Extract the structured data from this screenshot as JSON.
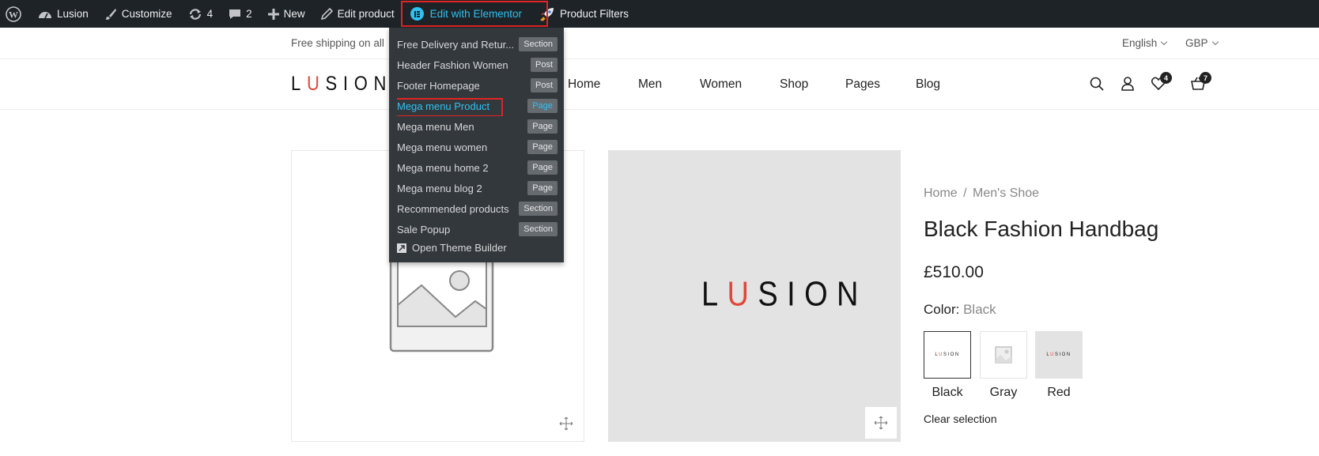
{
  "adminbar": {
    "site_name": "Lusion",
    "customize": "Customize",
    "updates": "4",
    "comments": "2",
    "new": "New",
    "edit_product": "Edit product",
    "edit_elementor": "Edit with Elementor",
    "product_filters": "Product Filters"
  },
  "elementor_menu": {
    "items": [
      {
        "label": "Free Delivery and Retur...",
        "tag": "Section"
      },
      {
        "label": "Header Fashion Women",
        "tag": "Post"
      },
      {
        "label": "Footer Homepage",
        "tag": "Post"
      },
      {
        "label": "Mega menu Product",
        "tag": "Page",
        "active": true
      },
      {
        "label": "Mega menu Men",
        "tag": "Page"
      },
      {
        "label": "Mega menu women",
        "tag": "Page"
      },
      {
        "label": "Mega menu home 2",
        "tag": "Page"
      },
      {
        "label": "Mega menu blog 2",
        "tag": "Page"
      },
      {
        "label": "Recommended products",
        "tag": "Section"
      },
      {
        "label": "Sale Popup",
        "tag": "Section"
      }
    ],
    "open_builder": "Open Theme Builder"
  },
  "topbar": {
    "shipping": "Free shipping on all",
    "language": "English",
    "currency": "GBP"
  },
  "header": {
    "logo": {
      "l": "L",
      "u": "U",
      "rest": "SION"
    },
    "nav": [
      "Home",
      "Men",
      "Women",
      "Shop",
      "Pages",
      "Blog"
    ],
    "wishlist_count": "4",
    "cart_count": "7"
  },
  "product": {
    "breadcrumb": {
      "home": "Home",
      "sep": "/",
      "category": "Men's Shoe"
    },
    "title": "Black Fashion Handbag",
    "price": "£510.00",
    "color_label": "Color:",
    "color_value": "Black",
    "swatches": [
      "Black",
      "Gray",
      "Red"
    ],
    "clear": "Clear selection"
  },
  "colors": {
    "adminbar_bg": "#1d2327",
    "elementor_accent": "#2ec1f2",
    "highlight": "#e02424",
    "logo_accent": "#e0473b"
  }
}
